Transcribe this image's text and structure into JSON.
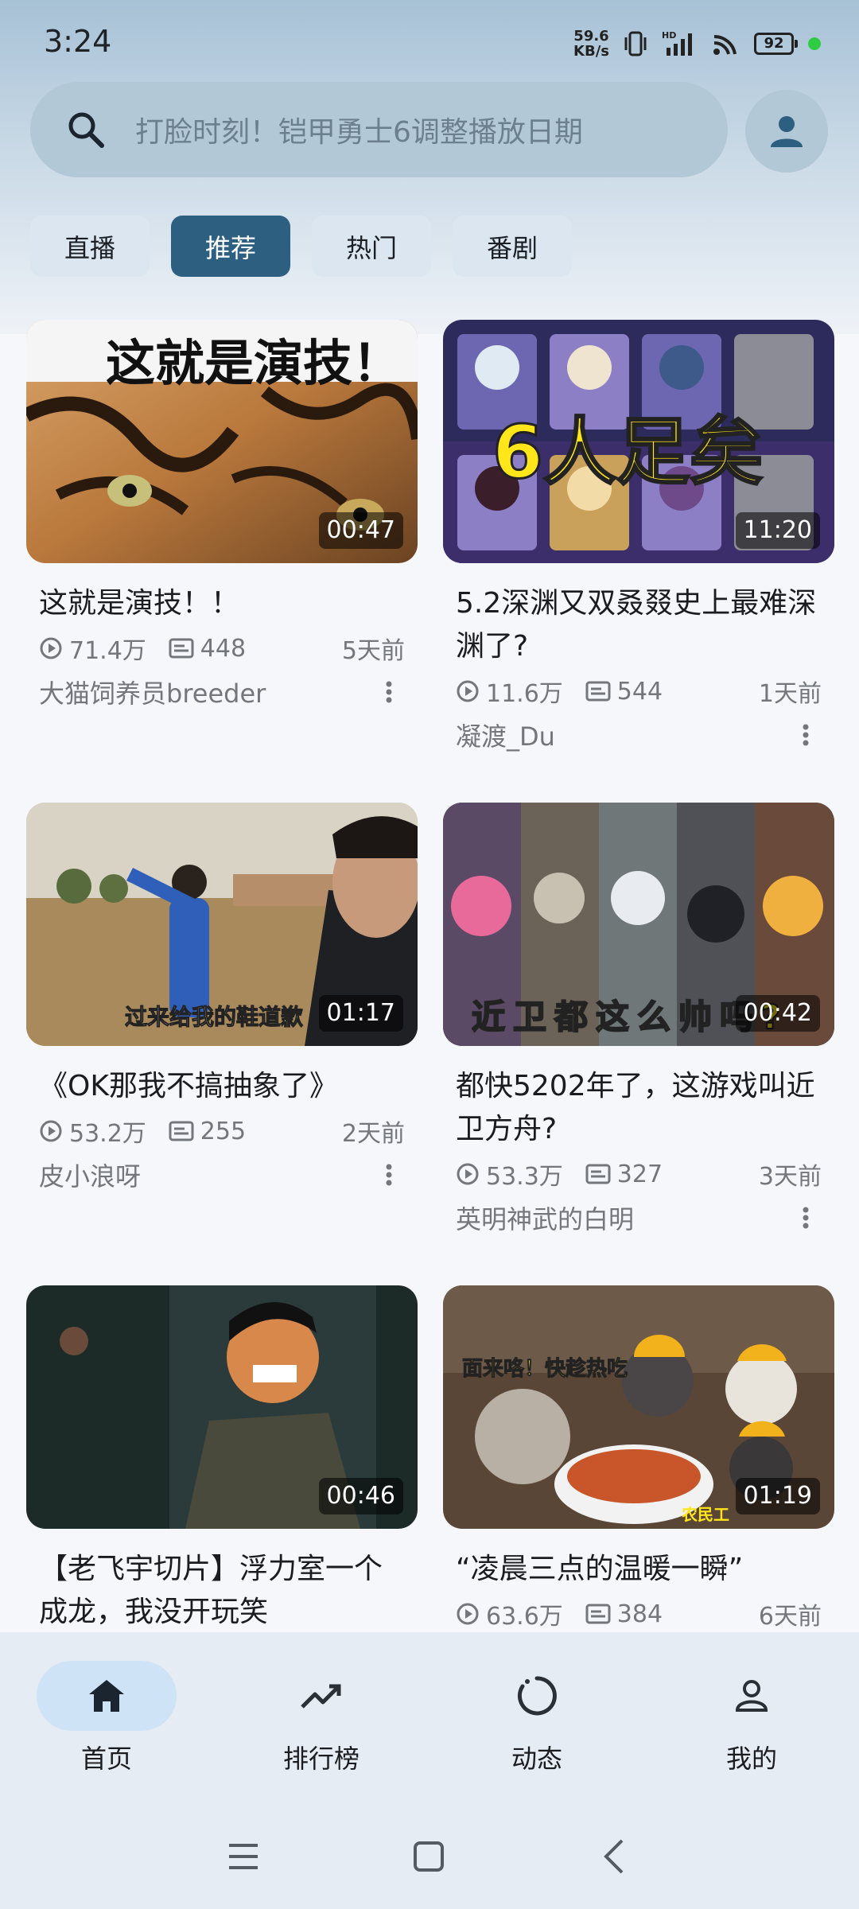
{
  "status_bar": {
    "time": "3:24",
    "net_speed_value": "59.6",
    "net_speed_unit": "KB/s",
    "battery": "92"
  },
  "search": {
    "placeholder": "打脸时刻！铠甲勇士6调整播放日期"
  },
  "tabs": [
    {
      "label": "直播",
      "active": false
    },
    {
      "label": "推荐",
      "active": true
    },
    {
      "label": "热门",
      "active": false
    },
    {
      "label": "番剧",
      "active": false
    }
  ],
  "videos": [
    {
      "title": "这就是演技！！",
      "duration": "00:47",
      "views": "71.4万",
      "danmaku": "448",
      "age": "5天前",
      "author": "大猫饲养员breeder",
      "thumb_caption": "这就是演技！"
    },
    {
      "title": "5.2深渊又双叒叕史上最难深渊了?",
      "duration": "11:20",
      "views": "11.6万",
      "danmaku": "544",
      "age": "1天前",
      "author": "凝渡_Du",
      "thumb_caption": "6人足矣"
    },
    {
      "title": "《OK那我不搞抽象了》",
      "duration": "01:17",
      "views": "53.2万",
      "danmaku": "255",
      "age": "2天前",
      "author": "皮小浪呀",
      "thumb_caption": "过来给我的鞋道歉"
    },
    {
      "title": "都快5202年了，这游戏叫近卫方舟?",
      "duration": "00:42",
      "views": "53.3万",
      "danmaku": "327",
      "age": "3天前",
      "author": "英明神武的白明",
      "thumb_caption": "近卫都这么帅吗?"
    },
    {
      "title": "【老飞宇切片】浮力室一个成龙，我没开玩笑",
      "duration": "00:46",
      "views": "",
      "danmaku": "",
      "age": "",
      "author": "",
      "thumb_caption": ""
    },
    {
      "title": "“凌晨三点的温暖一瞬”",
      "duration": "01:19",
      "views": "63.6万",
      "danmaku": "384",
      "age": "6天前",
      "author": "",
      "thumb_caption": "面来咯！快趁热吃",
      "thumb_caption2": "农民工"
    }
  ],
  "bottom_nav": [
    {
      "label": "首页",
      "icon": "home-icon",
      "active": true
    },
    {
      "label": "排行榜",
      "icon": "trending-icon",
      "active": false
    },
    {
      "label": "动态",
      "icon": "activity-icon",
      "active": false
    },
    {
      "label": "我的",
      "icon": "person-icon",
      "active": false
    }
  ],
  "colors": {
    "accent": "#2c5f80",
    "tab_bg": "#dbe6f0",
    "search_bg": "#b3c8d7",
    "nav_bg": "#e6ecf3"
  }
}
